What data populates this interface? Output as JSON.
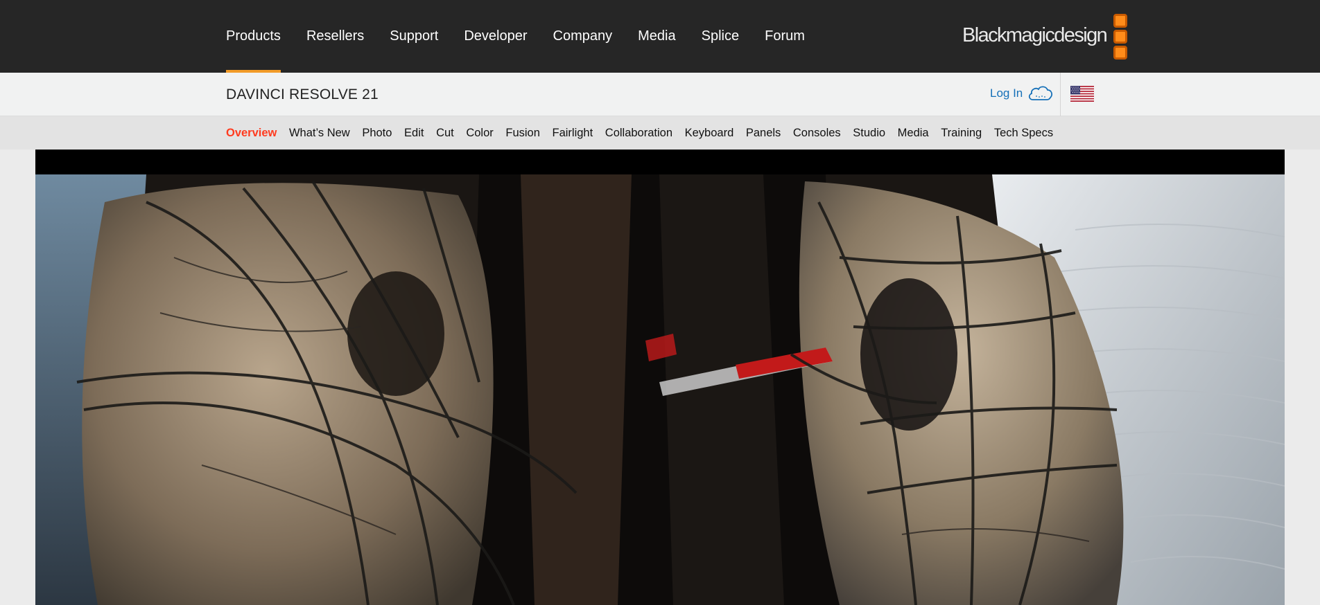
{
  "topnav": {
    "items": [
      "Products",
      "Resellers",
      "Support",
      "Developer",
      "Company",
      "Media",
      "Splice",
      "Forum"
    ],
    "active_index": 0
  },
  "logo": {
    "text": "Blackmagicdesign",
    "icon": "three-orange-squares-logo"
  },
  "product": {
    "title": "DAVINCI RESOLVE 21",
    "login_label": "Log In",
    "login_icon": "cloud-icon",
    "region_icon": "us-flag-icon"
  },
  "subnav": {
    "items": [
      "Overview",
      "What’s New",
      "Photo",
      "Edit",
      "Cut",
      "Color",
      "Fusion",
      "Fairlight",
      "Collaboration",
      "Keyboard",
      "Panels",
      "Consoles",
      "Studio",
      "Media",
      "Training",
      "Tech Specs"
    ],
    "active_index": 0
  },
  "colors": {
    "topbar_bg": "#262626",
    "active_underline": "#f29b28",
    "subnav_active": "#ff3b1f",
    "link_blue": "#1570b8",
    "logo_orange": "#ff8c1a"
  },
  "hero": {
    "image": "close-up of armored suit with rope netting in desert sand"
  }
}
